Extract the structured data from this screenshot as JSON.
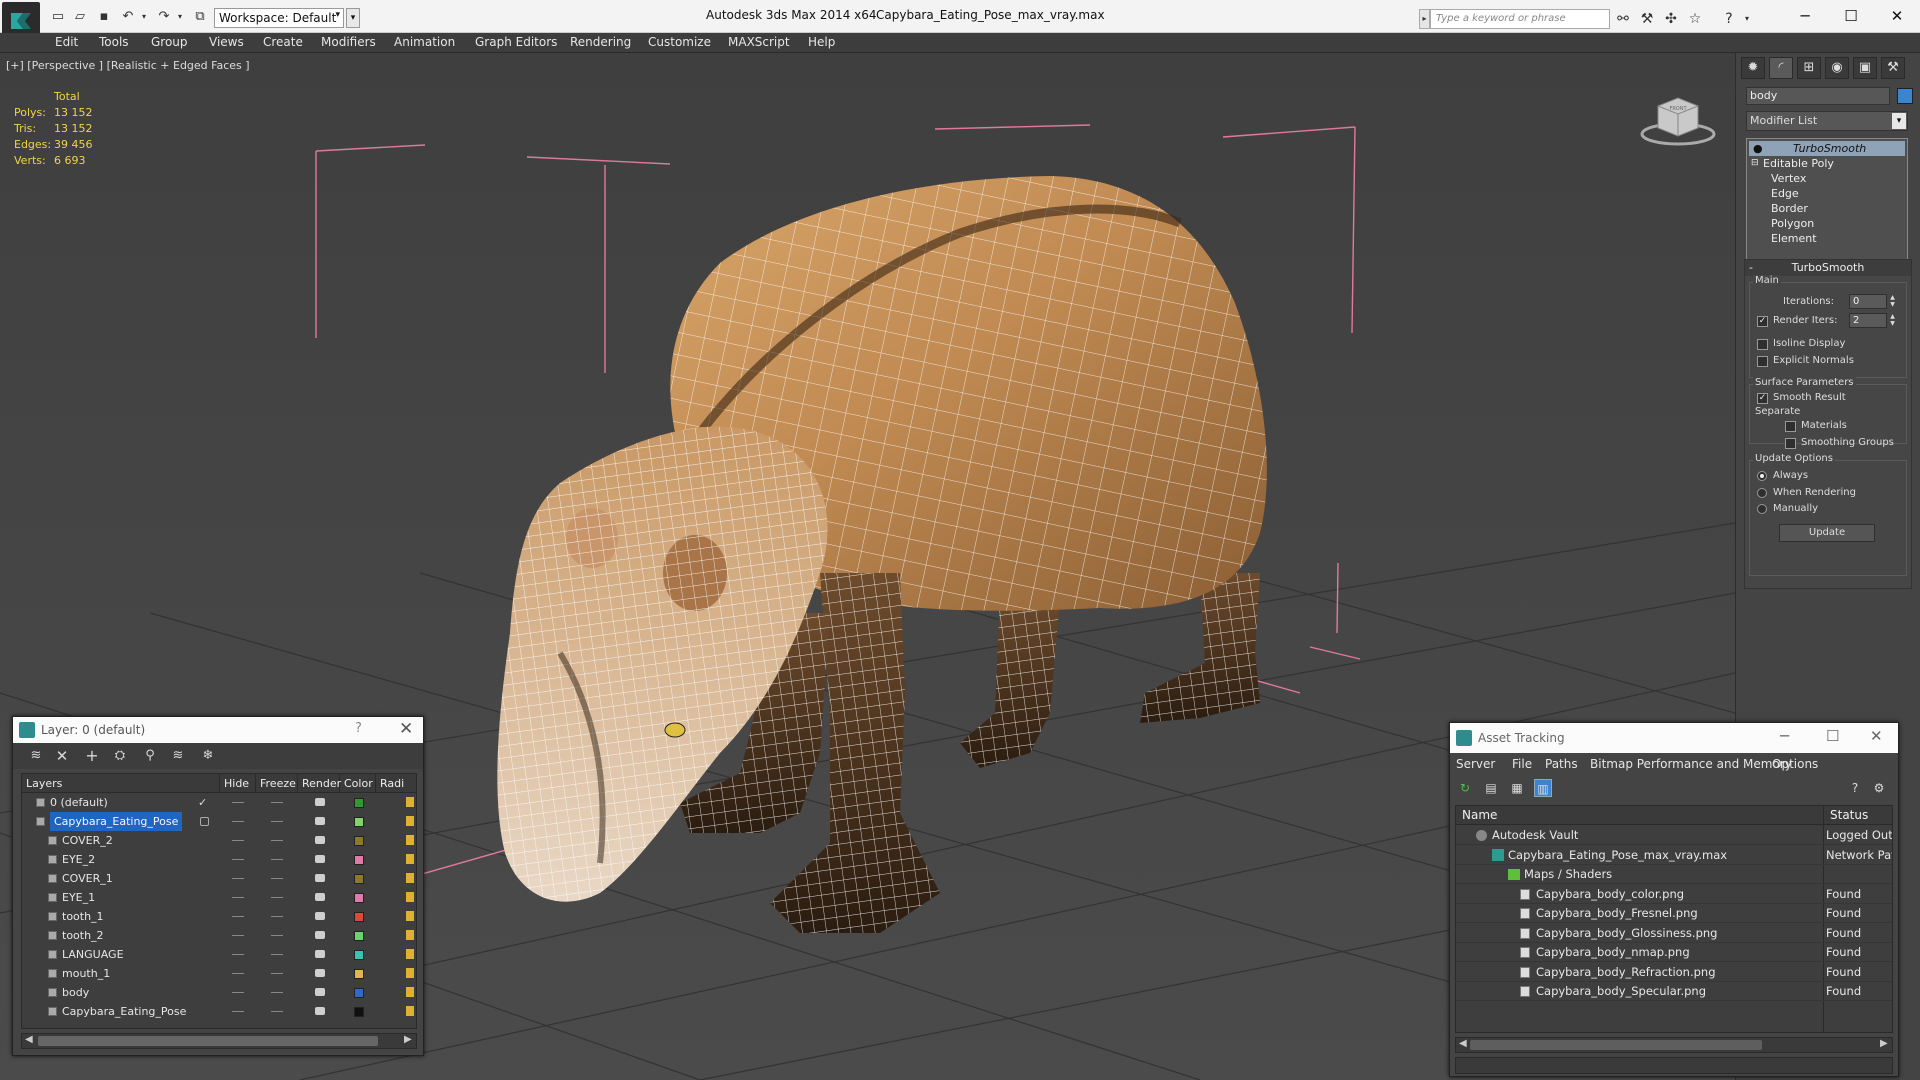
{
  "titlebar": {
    "workspace": "Workspace: Default",
    "app_title": "Autodesk 3ds Max  2014 x64",
    "doc_title": "Capybara_Eating_Pose_max_vray.max",
    "search_placeholder": "Type a keyword or phrase"
  },
  "menu": [
    "Edit",
    "Tools",
    "Group",
    "Views",
    "Create",
    "Modifiers",
    "Animation",
    "Graph Editors",
    "Rendering",
    "Customize",
    "MAXScript",
    "Help"
  ],
  "viewport": {
    "label": "[+] [Perspective ] [Realistic + Edged Faces ]",
    "stats_header": "Total",
    "stats": [
      {
        "k": "Polys:",
        "v": "13 152"
      },
      {
        "k": "Tris:",
        "v": "13 152"
      },
      {
        "k": "Edges:",
        "v": "39 456"
      },
      {
        "k": "Verts:",
        "v": "6 693"
      }
    ],
    "viewcube_text": "FRONT"
  },
  "command_panel": {
    "object_name": "body",
    "object_color": "#3d84cf",
    "modifier_list": "Modifier List",
    "stack": [
      "TurboSmooth",
      "Editable Poly",
      "Vertex",
      "Edge",
      "Border",
      "Polygon",
      "Element"
    ],
    "turbosmooth": {
      "title": "TurboSmooth",
      "main_label": "Main",
      "iterations_label": "Iterations:",
      "iterations": "0",
      "render_iters_label": "Render Iters:",
      "render_iters": "2",
      "render_iters_checked": true,
      "isoline_label": "Isoline Display",
      "explicit_normals_label": "Explicit Normals",
      "surface_params_label": "Surface Parameters",
      "smooth_result_label": "Smooth Result",
      "separate_label": "Separate",
      "materials_label": "Materials",
      "smoothing_groups_label": "Smoothing Groups",
      "update_options_label": "Update Options",
      "always_label": "Always",
      "when_rendering_label": "When Rendering",
      "manually_label": "Manually",
      "update_button": "Update"
    }
  },
  "layer_window": {
    "title": "Layer: 0 (default)",
    "help": "?",
    "columns": [
      "Layers",
      "Hide",
      "Freeze",
      "Render",
      "Color",
      "Radi"
    ],
    "rows": [
      {
        "name": "0 (default)",
        "level": 1,
        "color": "#2f9a2f",
        "checked": true
      },
      {
        "name": "Capybara_Eating_Pose",
        "level": 1,
        "color": "#7fd46a",
        "selected": true
      },
      {
        "name": "COVER_2",
        "level": 2,
        "color": "#8c7a2a"
      },
      {
        "name": "EYE_2",
        "level": 2,
        "color": "#e07aa8"
      },
      {
        "name": "COVER_1",
        "level": 2,
        "color": "#8c7a2a"
      },
      {
        "name": "EYE_1",
        "level": 2,
        "color": "#e07aa8"
      },
      {
        "name": "tooth_1",
        "level": 2,
        "color": "#d94a3a"
      },
      {
        "name": "tooth_2",
        "level": 2,
        "color": "#6ad46a"
      },
      {
        "name": "LANGUAGE",
        "level": 2,
        "color": "#3ac4b0"
      },
      {
        "name": "mouth_1",
        "level": 2,
        "color": "#e0b84a"
      },
      {
        "name": "body",
        "level": 2,
        "color": "#2f6ac4"
      },
      {
        "name": "Capybara_Eating_Pose",
        "level": 2,
        "color": "#111111"
      }
    ]
  },
  "asset_window": {
    "title": "Asset Tracking",
    "menu": [
      "Server",
      "File",
      "Paths",
      "Bitmap Performance and Memory",
      "Options"
    ],
    "col_name": "Name",
    "col_status": "Status",
    "rows": [
      {
        "name": "Autodesk Vault",
        "level": 1,
        "icon": "vault",
        "status": "Logged Out"
      },
      {
        "name": "Capybara_Eating_Pose_max_vray.max",
        "level": 2,
        "icon": "max",
        "status": "Network Path"
      },
      {
        "name": "Maps / Shaders",
        "level": 3,
        "icon": "folder",
        "status": ""
      },
      {
        "name": "Capybara_body_color.png",
        "level": 4,
        "icon": "file",
        "status": "Found"
      },
      {
        "name": "Capybara_body_Fresnel.png",
        "level": 4,
        "icon": "file",
        "status": "Found"
      },
      {
        "name": "Capybara_body_Glossiness.png",
        "level": 4,
        "icon": "file",
        "status": "Found"
      },
      {
        "name": "Capybara_body_nmap.png",
        "level": 4,
        "icon": "file",
        "status": "Found"
      },
      {
        "name": "Capybara_body_Refraction.png",
        "level": 4,
        "icon": "file",
        "status": "Found"
      },
      {
        "name": "Capybara_body_Specular.png",
        "level": 4,
        "icon": "file",
        "status": "Found"
      }
    ]
  }
}
